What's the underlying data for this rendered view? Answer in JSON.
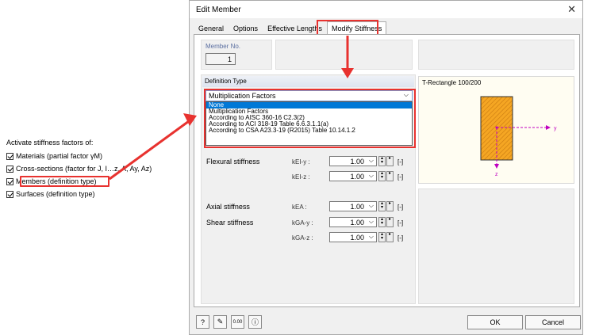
{
  "left_panel": {
    "title": "Activate stiffness factors of:",
    "items": [
      {
        "label": "Materials (partial factor γM)",
        "checked": true
      },
      {
        "label": "Cross-sections (factor for J, I…z, A, Ay, Az)",
        "checked": true
      },
      {
        "label": "Members (definition type)",
        "checked": true
      },
      {
        "label": "Surfaces (definition type)",
        "checked": true
      }
    ]
  },
  "dialog": {
    "title": "Edit Member",
    "close_symbol": "✕",
    "tabs": [
      "General",
      "Options",
      "Effective Lengths",
      "Modify Stiffness"
    ],
    "member_no_label": "Member No.",
    "member_no_value": "1",
    "definition_type_label": "Definition Type",
    "definition_selected": "Multiplication Factors",
    "definition_options": [
      "None",
      "Multiplication Factors",
      "According to AISC 360-16 C2.3(2)",
      "According to ACI 318-19 Table 6.6.3.1.1(a)",
      "According to CSA A23.3-19 (R2015) Table 10.14.1.2"
    ],
    "preview_title": "T-Rectangle 100/200",
    "axis_y": "y",
    "axis_z": "z",
    "flexural_label": "Flexural stiffness",
    "axial_label": "Axial stiffness",
    "shear_label": "Shear stiffness",
    "rows": [
      {
        "k": "kEI-y :",
        "value": "1.00",
        "unit": "[-]"
      },
      {
        "k": "kEI-z :",
        "value": "1.00",
        "unit": "[-]"
      },
      {
        "k": "kEA :",
        "value": "1.00",
        "unit": "[-]"
      },
      {
        "k": "kGA-y :",
        "value": "1.00",
        "unit": "[-]"
      },
      {
        "k": "kGA-z :",
        "value": "1.00",
        "unit": "[-]"
      }
    ],
    "ok_label": "OK",
    "cancel_label": "Cancel",
    "icon_0_text": "0.00"
  },
  "colors": {
    "highlight": "#e8322f",
    "accent": "#0078d7",
    "section_fill": "#f5a623"
  }
}
